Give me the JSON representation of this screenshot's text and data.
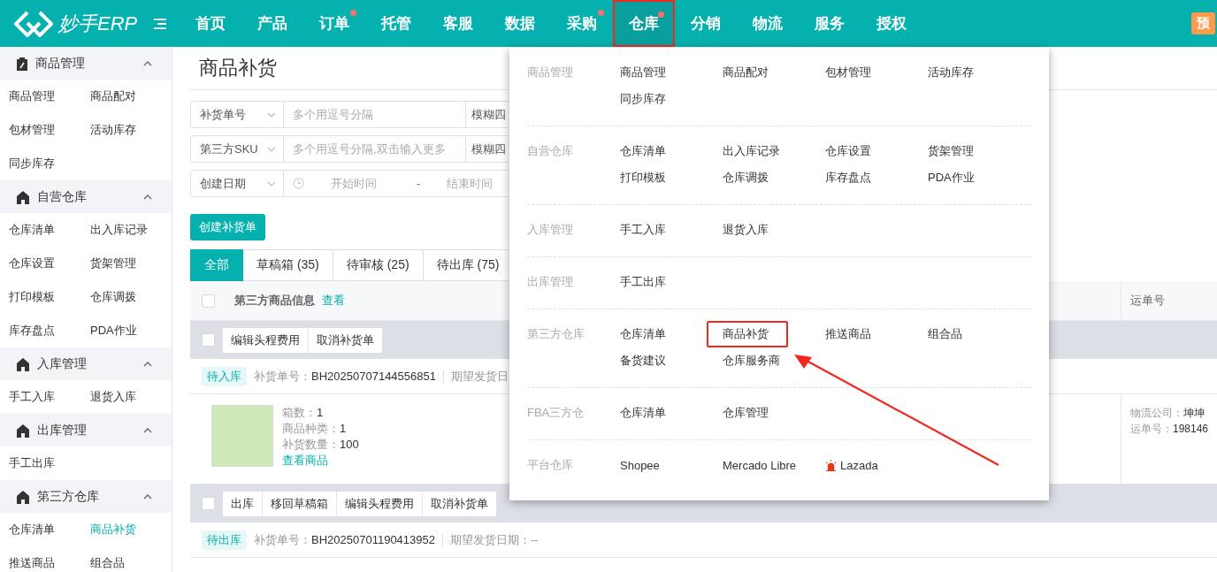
{
  "header": {
    "logo": "妙手ERP",
    "nav": [
      {
        "label": "首页",
        "selected": false,
        "dot": false
      },
      {
        "label": "产品",
        "selected": false,
        "dot": false
      },
      {
        "label": "订单",
        "selected": false,
        "dot": true
      },
      {
        "label": "托管",
        "selected": false,
        "dot": false
      },
      {
        "label": "客服",
        "selected": false,
        "dot": false
      },
      {
        "label": "数据",
        "selected": false,
        "dot": false
      },
      {
        "label": "采购",
        "selected": false,
        "dot": true
      },
      {
        "label": "仓库",
        "selected": true,
        "dot": true
      },
      {
        "label": "分销",
        "selected": false,
        "dot": false
      },
      {
        "label": "物流",
        "selected": false,
        "dot": false
      },
      {
        "label": "服务",
        "selected": false,
        "dot": false
      },
      {
        "label": "授权",
        "selected": false,
        "dot": false
      }
    ],
    "badge": "预"
  },
  "sidebar": {
    "groups": [
      {
        "title": "商品管理",
        "expanded": true,
        "items": [
          {
            "label": "商品管理",
            "selected": false
          },
          {
            "label": "商品配对",
            "selected": false
          },
          {
            "label": "包材管理",
            "selected": false
          },
          {
            "label": "活动库存",
            "selected": false
          },
          {
            "label": "同步库存",
            "selected": false
          }
        ]
      },
      {
        "title": "自营仓库",
        "expanded": true,
        "items": [
          {
            "label": "仓库清单",
            "selected": false
          },
          {
            "label": "出入库记录",
            "selected": false
          },
          {
            "label": "仓库设置",
            "selected": false
          },
          {
            "label": "货架管理",
            "selected": false
          },
          {
            "label": "打印模板",
            "selected": false
          },
          {
            "label": "仓库调拨",
            "selected": false
          },
          {
            "label": "库存盘点",
            "selected": false
          },
          {
            "label": "PDA作业",
            "selected": false
          }
        ]
      },
      {
        "title": "入库管理",
        "expanded": true,
        "items": [
          {
            "label": "手工入库",
            "selected": false
          },
          {
            "label": "退货入库",
            "selected": false
          }
        ]
      },
      {
        "title": "出库管理",
        "expanded": true,
        "items": [
          {
            "label": "手工出库",
            "selected": false
          }
        ]
      },
      {
        "title": "第三方仓库",
        "expanded": true,
        "items": [
          {
            "label": "仓库清单",
            "selected": false
          },
          {
            "label": "商品补货",
            "selected": true
          },
          {
            "label": "推送商品",
            "selected": false
          },
          {
            "label": "组合品",
            "selected": false
          }
        ]
      }
    ]
  },
  "page": {
    "title": "商品补货",
    "filters": [
      {
        "kind": "text",
        "field": "补货单号",
        "placeholder": "多个用逗号分隔",
        "mode": "模糊四"
      },
      {
        "kind": "text",
        "field": "第三方SKU",
        "placeholder": "多个用逗号分隔,双击输入更多",
        "mode": "模糊四"
      },
      {
        "kind": "date",
        "field": "创建日期",
        "start": "开始时间",
        "separator": "-",
        "end": "结束时间"
      }
    ],
    "create_button": "创建补货单",
    "tabs": [
      {
        "label": "全部",
        "selected": true
      },
      {
        "label": "草稿箱 (35)",
        "selected": false
      },
      {
        "label": "待审核 (25)",
        "selected": false
      },
      {
        "label": "待出库 (75)",
        "selected": false
      }
    ],
    "table": {
      "select_all_checked": false,
      "column_1": "第三方商品信息",
      "view_link": "查看",
      "column_last": "运单号",
      "orders": [
        {
          "checked": false,
          "actions": [
            "编辑头程费用",
            "取消补货单"
          ],
          "status": "待入库",
          "number_label": "补货单号：",
          "number": "BH20250707144556851",
          "date": "期望发货日",
          "product": {
            "lines": [
              {
                "label": "箱数：",
                "value": "1"
              },
              {
                "label": "商品种类：",
                "value": "1"
              },
              {
                "label": "补货数量：",
                "value": "100"
              }
            ],
            "link": "查看商品"
          },
          "shipping": [
            {
              "label": "物流公司：",
              "value": "坤坤"
            },
            {
              "label": "运单号：",
              "value": "198146"
            }
          ]
        },
        {
          "checked": false,
          "actions": [
            "出库",
            "移回草稿箱",
            "编辑头程费用",
            "取消补货单"
          ],
          "status": "待出库",
          "number_label": "补货单号：",
          "number": "BH20250701190413952",
          "date": "期望发货日期：--"
        }
      ]
    }
  },
  "menu": {
    "sections": [
      {
        "title": "商品管理",
        "items": [
          {
            "label": "商品管理",
            "selected": false
          },
          {
            "label": "商品配对",
            "selected": false
          },
          {
            "label": "包材管理",
            "selected": false
          },
          {
            "label": "活动库存",
            "selected": false
          },
          {
            "label": "同步库存",
            "selected": false
          }
        ]
      },
      {
        "title": "自营仓库",
        "items": [
          {
            "label": "仓库清单",
            "selected": false
          },
          {
            "label": "出入库记录",
            "selected": false
          },
          {
            "label": "仓库设置",
            "selected": false
          },
          {
            "label": "货架管理",
            "selected": false
          },
          {
            "label": "打印模板",
            "selected": false
          },
          {
            "label": "仓库调拨",
            "selected": false
          },
          {
            "label": "库存盘点",
            "selected": false
          },
          {
            "label": "PDA作业",
            "selected": false
          }
        ]
      },
      {
        "title": "入库管理",
        "items": [
          {
            "label": "手工入库",
            "selected": false
          },
          {
            "label": "退货入库",
            "selected": false
          }
        ]
      },
      {
        "title": "出库管理",
        "items": [
          {
            "label": "手工出库",
            "selected": false
          }
        ]
      },
      {
        "title": "第三方仓库",
        "items": [
          {
            "label": "仓库清单",
            "selected": false
          },
          {
            "label": "商品补货",
            "selected": true
          },
          {
            "label": "推送商品",
            "selected": false
          },
          {
            "label": "组合品",
            "selected": false
          },
          {
            "label": "备货建议",
            "selected": false
          },
          {
            "label": "仓库服务商",
            "selected": false
          }
        ]
      },
      {
        "title": "FBA三方仓",
        "items": [
          {
            "label": "仓库清单",
            "selected": false
          },
          {
            "label": "仓库管理",
            "selected": false
          }
        ]
      },
      {
        "title": "平台仓库",
        "items": [
          {
            "label": "Shopee",
            "selected": false,
            "alert": false
          },
          {
            "label": "Mercado Libre",
            "selected": false,
            "alert": false
          },
          {
            "label": "Lazada",
            "selected": false,
            "alert": true
          }
        ]
      }
    ]
  }
}
